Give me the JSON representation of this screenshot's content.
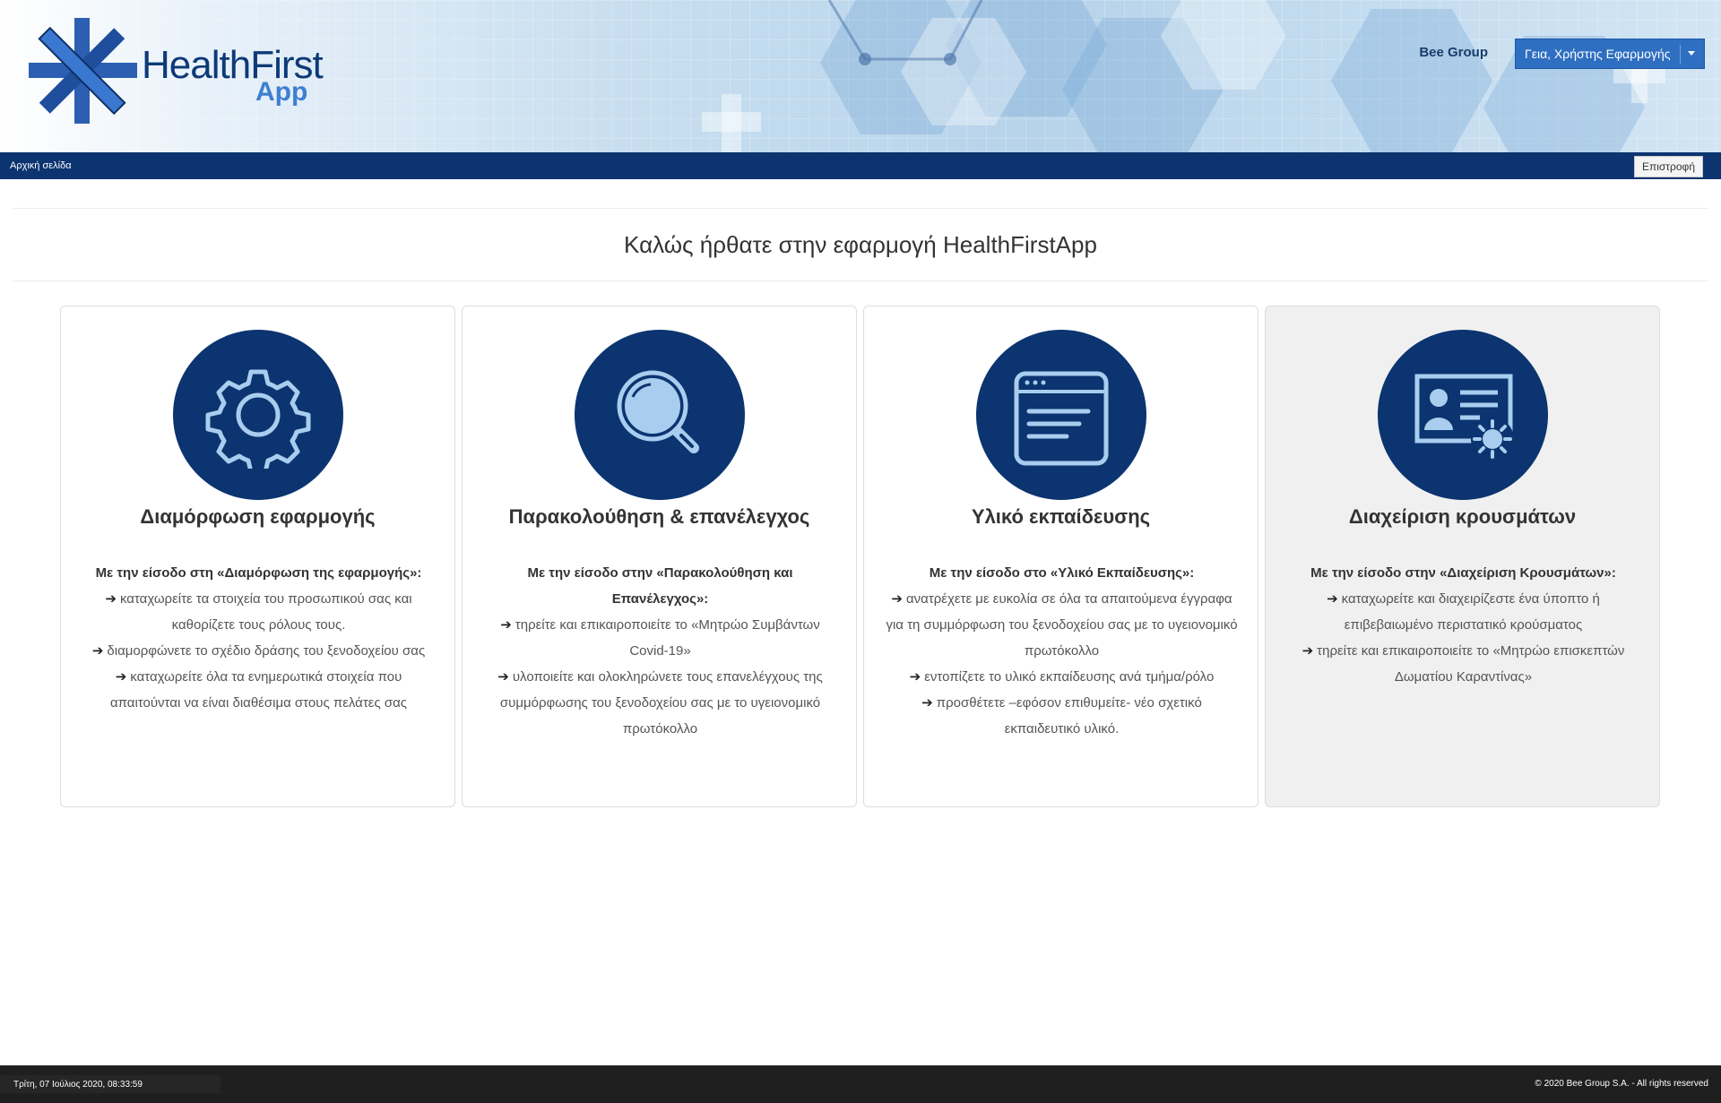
{
  "header": {
    "logo_text_main": "HealthFirst",
    "logo_text_sub": "App",
    "org_link": "Bee Group",
    "user_menu_label": "Γεια, Χρήστης Εφαρμογής"
  },
  "navbar": {
    "home_label": "Αρχική σελίδα",
    "back_button": "Επιστροφή"
  },
  "welcome": "Καλώς ήρθατε στην εφαρμογή HealthFirstApp",
  "cards": [
    {
      "icon": "gear-icon",
      "title": "Διαμόρφωση εφαρμογής",
      "lead": "Με την είσοδο στη «Διαμόρφωση της εφαρμογής»:",
      "items": [
        "καταχωρείτε τα στοιχεία του προσωπικού σας και καθορίζετε τους ρόλους τους.",
        "διαμορφώνετε το σχέδιο δράσης του ξενοδοχείου σας",
        "καταχωρείτε όλα τα ενημερωτικά στοιχεία που απαιτούνται να είναι διαθέσιμα στους πελάτες σας"
      ]
    },
    {
      "icon": "magnifier-icon",
      "title": "Παρακολούθηση & επανέλεγχος",
      "lead": "Με την είσοδο στην «Παρακολούθηση και Επανέλεγχος»:",
      "items": [
        "τηρείτε και επικαιροποιείτε το «Μητρώο Συμβάντων Covid-19»",
        "υλοποιείτε και ολοκληρώνετε τους επανελέγχους της συμμόρφωσης του ξενοδοχείου σας με το υγειονομικό πρωτόκολλο"
      ]
    },
    {
      "icon": "browser-window-icon",
      "title": "Υλικό εκπαίδευσης",
      "lead": "Με την είσοδο στο «Υλικό Εκπαίδευσης»:",
      "items": [
        "ανατρέχετε με ευκολία σε όλα τα απαιτούμενα έγγραφα για τη συμμόρφωση του ξενοδοχείου σας με το υγειονομικό πρωτόκολλο",
        "εντοπίζετε το υλικό εκπαίδευσης ανά τμήμα/ρόλο",
        "προσθέτετε –εφόσον επιθυμείτε- νέο σχετικό εκπαιδευτικό υλικό."
      ]
    },
    {
      "icon": "id-card-virus-icon",
      "title": "Διαχείριση κρουσμάτων",
      "lead": "Με την είσοδο στην «Διαχείριση Κρουσμάτων»:",
      "items": [
        "καταχωρείτε και διαχειρίζεστε ένα ύποπτο ή επιβεβαιωμένο περιστατικό κρούσματος",
        "τηρείτε και επικαιροποιείτε το «Μητρώο επισκεπτών Δωματίου Καραντίνας»"
      ]
    }
  ],
  "footer": {
    "datetime": "Τρίτη, 07 Ιούλιος 2020, 08:33:59",
    "copyright": "© 2020 Bee Group S.A. - All rights reserved"
  },
  "colors": {
    "primary_dark": "#0b3470",
    "accent": "#2f6fc2",
    "footer_bg": "#1f1f1f"
  }
}
